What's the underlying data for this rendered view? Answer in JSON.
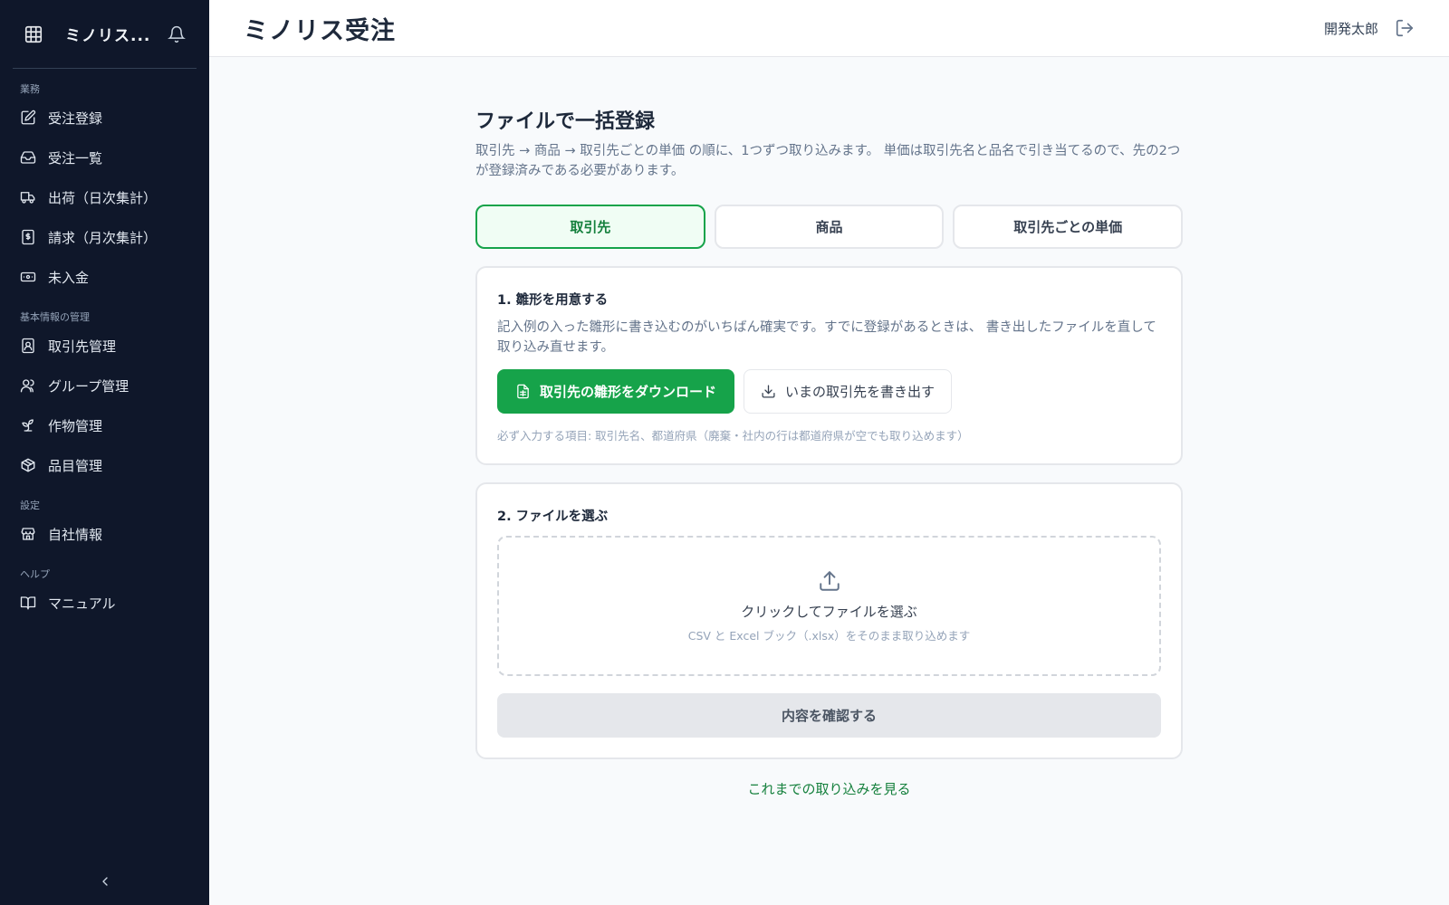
{
  "sidebar": {
    "title": "ミノリス...",
    "sections": [
      {
        "label": "業務"
      },
      {
        "label": "基本情報の管理"
      },
      {
        "label": "設定"
      },
      {
        "label": "ヘルプ"
      }
    ],
    "items": [
      {
        "label": "受注登録",
        "icon": "edit-icon"
      },
      {
        "label": "受注一覧",
        "icon": "inbox-icon"
      },
      {
        "label": "出荷（日次集計）",
        "icon": "truck-icon"
      },
      {
        "label": "請求（月次集計）",
        "icon": "invoice-icon"
      },
      {
        "label": "未入金",
        "icon": "cash-icon"
      },
      {
        "label": "取引先管理",
        "icon": "contact-icon"
      },
      {
        "label": "グループ管理",
        "icon": "users-icon"
      },
      {
        "label": "作物管理",
        "icon": "sprout-icon"
      },
      {
        "label": "品目管理",
        "icon": "package-icon"
      },
      {
        "label": "自社情報",
        "icon": "store-icon"
      },
      {
        "label": "マニュアル",
        "icon": "book-icon"
      }
    ]
  },
  "header": {
    "title": "ミノリス受注",
    "user": "開発太郎"
  },
  "main": {
    "heading": "ファイルで一括登録",
    "description": "取引先 → 商品 → 取引先ごとの単価 の順に、1つずつ取り込みます。 単価は取引先名と品名で引き当てるので、先の2つが登録済みである必要があります。",
    "tabs": [
      {
        "label": "取引先",
        "active": true
      },
      {
        "label": "商品",
        "active": false
      },
      {
        "label": "取引先ごとの単価",
        "active": false
      }
    ],
    "step1": {
      "title": "1. 雛形を用意する",
      "description": "記入例の入った雛形に書き込むのがいちばん確実です。すでに登録があるときは、 書き出したファイルを直して取り込み直せます。",
      "download_label": "取引先の雛形をダウンロード",
      "export_label": "いまの取引先を書き出す",
      "note": "必ず入力する項目: 取引先名、都道府県（廃棄・社内の行は都道府県が空でも取り込めます）"
    },
    "step2": {
      "title": "2. ファイルを選ぶ",
      "drop_title": "クリックしてファイルを選ぶ",
      "drop_sub": "CSV と Excel ブック（.xlsx）をそのまま取り込めます",
      "confirm_label": "内容を確認する"
    },
    "history_link": "これまでの取り込みを見る"
  },
  "colors": {
    "sidebar_bg": "#0f172a",
    "accent": "#16a34a",
    "accent_light": "#f0fdf4"
  }
}
